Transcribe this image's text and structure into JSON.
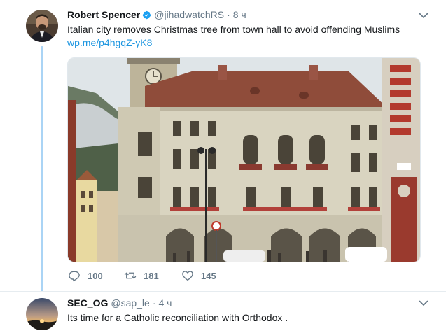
{
  "tweets": [
    {
      "display_name": "Robert Spencer",
      "verified": true,
      "handle": "@jihadwatchRS",
      "separator": "·",
      "timestamp": "8 ч",
      "text": "Italian city removes Christmas tree from town hall to avoid offending Muslims",
      "link": "wp.me/p4hgqZ-yK8",
      "actions": {
        "replies": "100",
        "retweets": "181",
        "likes": "145"
      }
    },
    {
      "display_name": "SEC_OG",
      "verified": false,
      "handle": "@sap_le",
      "separator": "·",
      "timestamp": "4 ч",
      "text": "Its time for a Catholic reconciliation with Orthodox ."
    }
  ],
  "icons": {
    "verified": "verified-badge-icon",
    "caret": "chevron-down-icon",
    "reply": "reply-icon",
    "retweet": "retweet-icon",
    "like": "heart-icon"
  },
  "colors": {
    "link": "#1b95e0",
    "verified": "#1da1f2",
    "thread_line": "#aad4f5",
    "muted": "#657786"
  }
}
